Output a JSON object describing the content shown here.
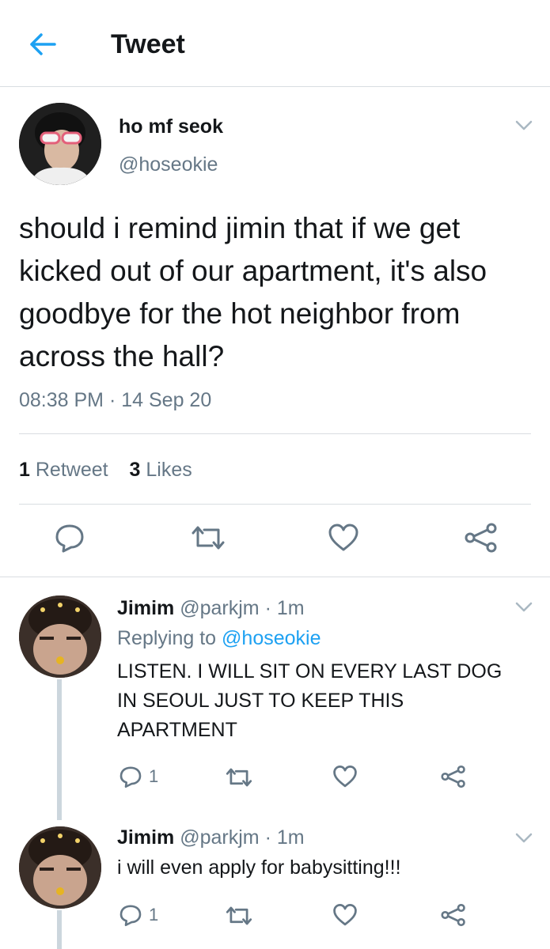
{
  "header": {
    "title": "Tweet",
    "back_icon": "arrow-left-icon",
    "accent": "#1da1f2"
  },
  "tweet": {
    "display_name": "ho mf seok",
    "handle": "@hoseokie",
    "text": "should i remind jimin that if we get kicked out of our apartment, it's also goodbye for the hot neighbor from across the hall?",
    "time": "08:38 PM",
    "separator": " · ",
    "date": "14 Sep 20",
    "retweet_count": "1",
    "retweet_label": "Retweet",
    "like_count": "3",
    "like_label": "Likes",
    "actions": [
      "reply-icon",
      "retweet-icon",
      "like-icon",
      "share-icon"
    ]
  },
  "replies": [
    {
      "name": "Jimim",
      "handle": "@parkjm",
      "time": "1m",
      "replying_prefix": "Replying to ",
      "replying_to": "@hoseokie",
      "text": "LISTEN. I WILL SIT ON EVERY LAST DOG IN SEOUL JUST TO KEEP THIS APARTMENT",
      "reply_count": "1"
    },
    {
      "name": "Jimim",
      "handle": "@parkjm",
      "time": "1m",
      "text": "i will even apply for babysitting!!!",
      "reply_count": "1"
    }
  ],
  "colors": {
    "secondary_text": "#657786",
    "divider": "#d9dde1",
    "thread_line": "#ccd6dd"
  }
}
